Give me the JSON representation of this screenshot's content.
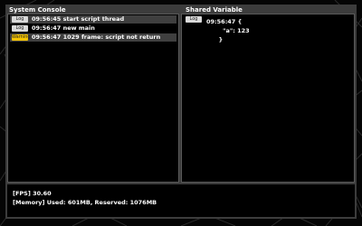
{
  "system_console": {
    "title": "System Console",
    "entries": [
      {
        "level": "Log",
        "text": "09:56:45  start script thread",
        "selected": true
      },
      {
        "level": "Log",
        "text": "09:56:47  new main",
        "selected": false
      },
      {
        "level": "Warning",
        "text": "09:56:47  1029 frame: script not return",
        "selected": true
      }
    ]
  },
  "shared_variable": {
    "title": "Shared Variable",
    "level": "Log",
    "time": "09:56:47",
    "lines": [
      "{",
      "\"a\": 123",
      "}"
    ]
  },
  "status_bar": {
    "fps": "[FPS] 30.60",
    "memory": "[Memory] Used: 601MB, Reserved: 1076MB"
  },
  "colors": {
    "warning_badge": "#f5c400",
    "log_badge": "#d9d9d9",
    "selected_row": "#3f3f3f"
  }
}
